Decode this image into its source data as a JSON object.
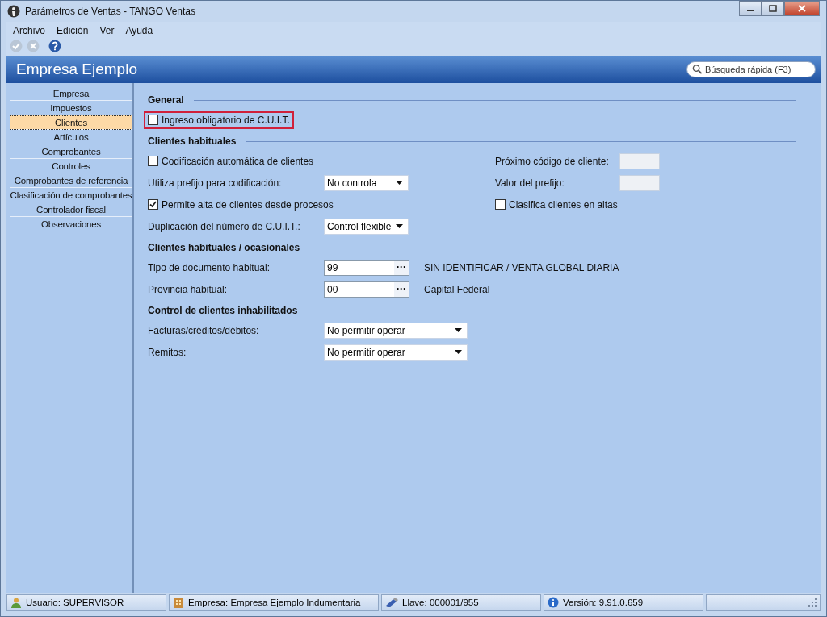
{
  "window": {
    "title": "Parámetros de Ventas - TANGO Ventas"
  },
  "menu": [
    "Archivo",
    "Edición",
    "Ver",
    "Ayuda"
  ],
  "toolbar": [
    {
      "kind": "accept",
      "disabled": true
    },
    {
      "kind": "cancel",
      "disabled": true
    },
    {
      "kind": "help",
      "disabled": false
    }
  ],
  "header": {
    "title": "Empresa Ejemplo",
    "search": {
      "placeholder": "Búsqueda rápida (F3)"
    }
  },
  "sidebar": {
    "items": [
      {
        "label": "Empresa",
        "selected": false
      },
      {
        "label": "Impuestos",
        "selected": false
      },
      {
        "label": "Clientes",
        "selected": true
      },
      {
        "label": "Artículos",
        "selected": false
      },
      {
        "label": "Comprobantes",
        "selected": false
      },
      {
        "label": "Controles",
        "selected": false
      },
      {
        "label": "Comprobantes de referencia",
        "selected": false
      },
      {
        "label": "Clasificación de comprobantes",
        "selected": false
      },
      {
        "label": "Controlador fiscal",
        "selected": false
      },
      {
        "label": "Observaciones",
        "selected": false
      }
    ]
  },
  "sections": [
    {
      "title": "General",
      "rows": [
        [
          {
            "kind": "checkbox",
            "label": "Ingreso obligatorio de C.U.I.T.",
            "checked": false,
            "highlighted": true
          }
        ]
      ]
    },
    {
      "title": "Clientes habituales",
      "rows": [
        [
          {
            "kind": "checkbox",
            "label": "Codificación automática de clientes",
            "checked": false,
            "highlighted": false
          },
          {
            "kind": "field",
            "label": "Próximo código de cliente:",
            "disabled": true
          }
        ],
        [
          {
            "kind": "select",
            "label": "Utiliza prefijo para codificación:",
            "value": "No controla"
          },
          {
            "kind": "field",
            "label": "Valor del prefijo:",
            "disabled": true
          }
        ],
        [
          {
            "kind": "checkbox",
            "label": "Permite alta de clientes desde procesos",
            "checked": true,
            "highlighted": false
          },
          {
            "kind": "checkbox",
            "label": "Clasifica clientes en altas",
            "checked": false,
            "highlighted": false
          }
        ],
        [
          {
            "kind": "select",
            "label": "Duplicación del número de C.U.I.T.:",
            "value": "Control flexible"
          }
        ]
      ]
    },
    {
      "title": "Clientes habituales / ocasionales",
      "rows": [
        [
          {
            "kind": "lookup",
            "label": "Tipo de documento habitual:",
            "value": "99",
            "button": "···",
            "description": "SIN IDENTIFICAR / VENTA GLOBAL DIARIA"
          }
        ],
        [
          {
            "kind": "lookup",
            "label": "Provincia habitual:",
            "value": "00",
            "button": "···",
            "description": "Capital Federal"
          }
        ]
      ]
    },
    {
      "title": "Control de clientes inhabilitados",
      "rows": [
        [
          {
            "kind": "select-wide",
            "label": "Facturas/créditos/débitos:",
            "value": "No permitir operar"
          }
        ],
        [
          {
            "kind": "select-wide",
            "label": "Remitos:",
            "value": "No permitir operar"
          }
        ]
      ]
    }
  ],
  "status_bar": [
    {
      "kind": "user",
      "text": "Usuario: SUPERVISOR"
    },
    {
      "kind": "company",
      "text": "Empresa: Empresa Ejemplo Indumentaria"
    },
    {
      "kind": "key",
      "text": "Llave: 000001/955"
    },
    {
      "kind": "info",
      "text": "Versión: 9.91.0.659"
    }
  ]
}
